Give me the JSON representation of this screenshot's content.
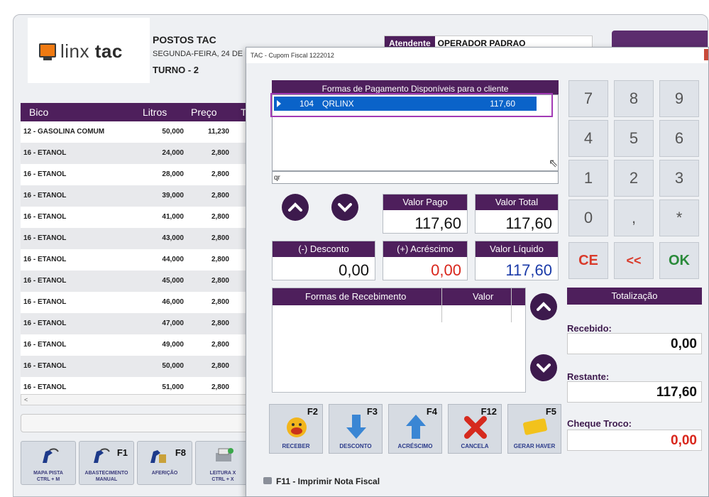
{
  "background": {
    "logo": {
      "prefix": "linx",
      "suffix": "tac"
    },
    "company_name": "POSTOS TAC",
    "date_line": "SEGUNDA-FEIRA, 24 DE",
    "turno": "TURNO - 2",
    "attendant_label": "Atendente",
    "attendant_value": "OPERADOR PADRAO",
    "fuel_table": {
      "headers": [
        "Bico",
        "Litros",
        "Preço",
        "To"
      ],
      "rows": [
        {
          "bico": "12 - GASOLINA COMUM",
          "litros": "50,000",
          "preco": "11,230"
        },
        {
          "bico": "16 - ETANOL",
          "litros": "24,000",
          "preco": "2,800"
        },
        {
          "bico": "16 - ETANOL",
          "litros": "28,000",
          "preco": "2,800"
        },
        {
          "bico": "16 - ETANOL",
          "litros": "39,000",
          "preco": "2,800"
        },
        {
          "bico": "16 - ETANOL",
          "litros": "41,000",
          "preco": "2,800"
        },
        {
          "bico": "16 - ETANOL",
          "litros": "43,000",
          "preco": "2,800"
        },
        {
          "bico": "16 - ETANOL",
          "litros": "44,000",
          "preco": "2,800"
        },
        {
          "bico": "16 - ETANOL",
          "litros": "45,000",
          "preco": "2,800"
        },
        {
          "bico": "16 - ETANOL",
          "litros": "46,000",
          "preco": "2,800"
        },
        {
          "bico": "16 - ETANOL",
          "litros": "47,000",
          "preco": "2,800"
        },
        {
          "bico": "16 - ETANOL",
          "litros": "49,000",
          "preco": "2,800"
        },
        {
          "bico": "16 - ETANOL",
          "litros": "50,000",
          "preco": "2,800"
        },
        {
          "bico": "16 - ETANOL",
          "litros": "51,000",
          "preco": "2,800"
        }
      ],
      "scroll_glyph": "<"
    },
    "toolbar": [
      {
        "label_1": "MAPA PISTA",
        "label_2": "CTRL + M",
        "key": ""
      },
      {
        "label_1": "ABASTECIMENTO",
        "label_2": "MANUAL",
        "key": "F1"
      },
      {
        "label_1": "AFERIÇÃO",
        "label_2": "",
        "key": "F8"
      },
      {
        "label_1": "LEITURA X",
        "label_2": "CTRL + X",
        "key": ""
      }
    ]
  },
  "dialog": {
    "title": "TAC - Cupom Fiscal 1222012",
    "payment_header": "Formas de Pagamento Disponíveis para o cliente",
    "payment_rows": [
      {
        "code": "104",
        "name": "QRLINX",
        "value": "117,60"
      }
    ],
    "filter_value": "qr",
    "valor_pago": {
      "label": "Valor Pago",
      "value": "117,60"
    },
    "valor_total": {
      "label": "Valor Total",
      "value": "117,60"
    },
    "desconto": {
      "label": "(-) Desconto",
      "value": "0,00"
    },
    "acrescimo": {
      "label": "(+) Acréscimo",
      "value": "0,00"
    },
    "valor_liquido": {
      "label": "Valor Líquido",
      "value": "117,60"
    },
    "receipt_grid": {
      "col_1": "Formas de Recebimento",
      "col_2": "Valor"
    },
    "keypad": [
      "7",
      "8",
      "9",
      "4",
      "5",
      "6",
      "1",
      "2",
      "3",
      "0",
      ",",
      "*",
      "CE",
      "<<",
      "OK"
    ],
    "totalizacao": {
      "header": "Totalização",
      "recebido_label": "Recebido:",
      "recebido_value": "0,00",
      "restante_label": "Restante:",
      "restante_value": "117,60",
      "cheque_label": "Cheque Troco:",
      "cheque_value": "0,00"
    },
    "actions": [
      {
        "key": "F2",
        "label": "RECEBER"
      },
      {
        "key": "F3",
        "label": "DESCONTO"
      },
      {
        "key": "F4",
        "label": "ACRÉSCIMO"
      },
      {
        "key": "F12",
        "label": "CANCELA"
      },
      {
        "key": "F5",
        "label": "GERAR HAVER"
      }
    ],
    "print_label": "F11 - Imprimir Nota Fiscal"
  },
  "colors": {
    "accent_purple": "#4e1f5c",
    "selection_blue": "#0a63c9",
    "red_value": "#d9261c",
    "blue_value": "#1a3aa8",
    "ok_green": "#2a8a3a"
  }
}
